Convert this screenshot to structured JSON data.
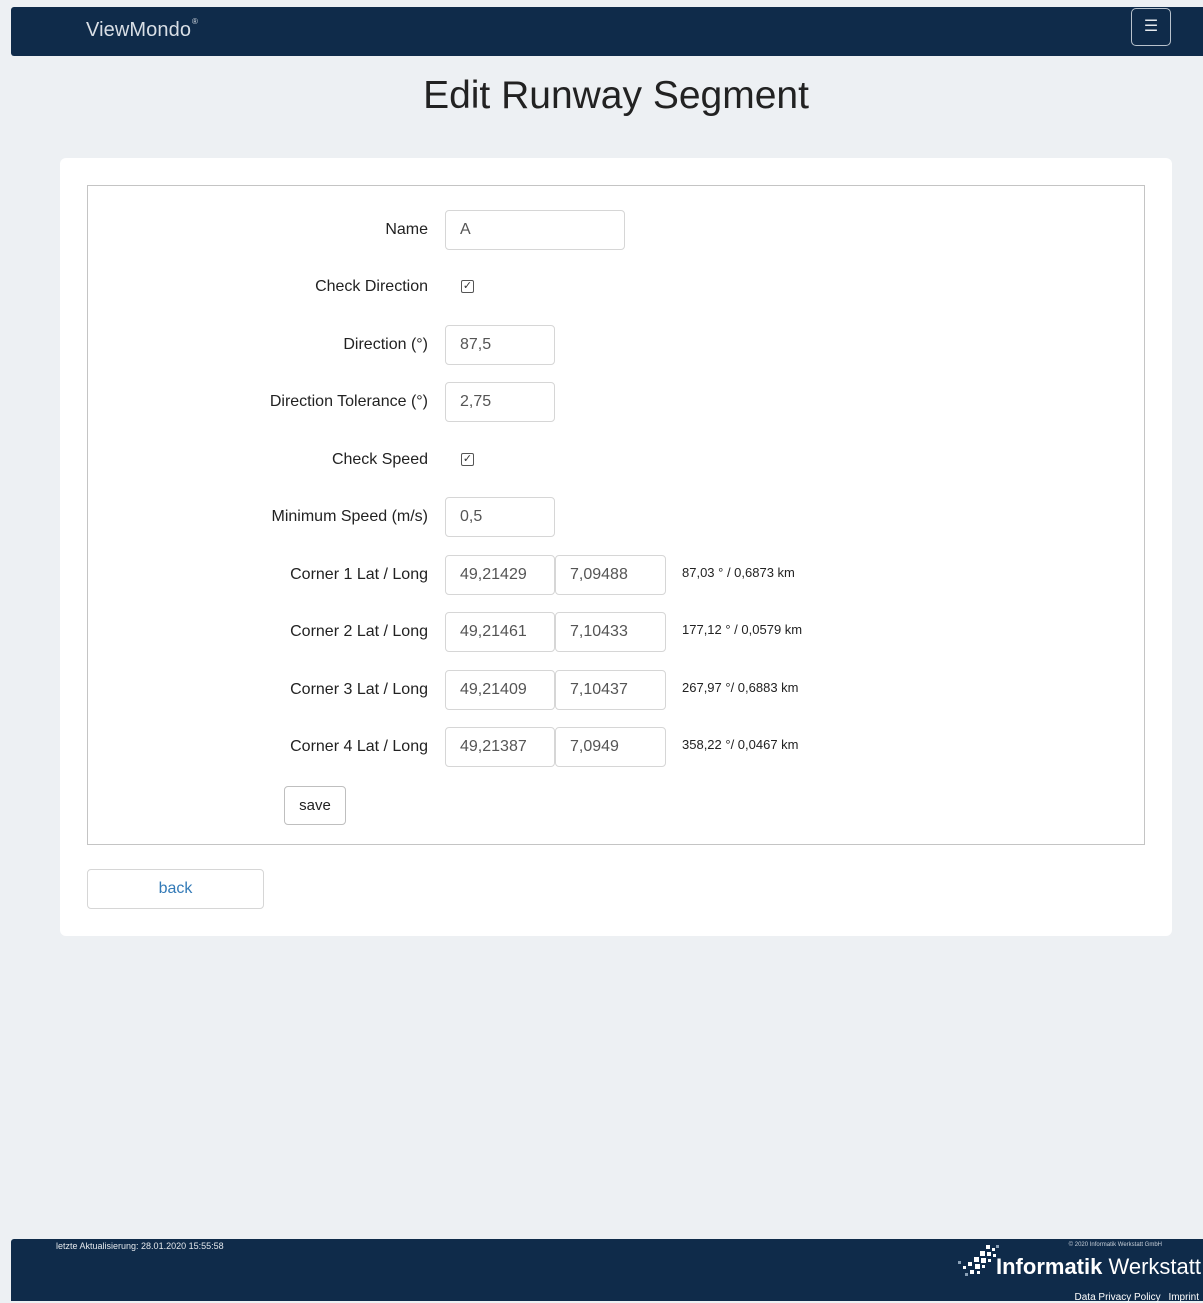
{
  "navbar": {
    "brand": "ViewMondo",
    "brand_mark": "®",
    "menu_icon": "hamburger-menu-icon"
  },
  "page": {
    "title": "Edit Runway Segment"
  },
  "form": {
    "name": {
      "label": "Name",
      "value": "A"
    },
    "check_direction": {
      "label": "Check Direction",
      "checked": true
    },
    "direction": {
      "label": "Direction (°)",
      "value": "87,5"
    },
    "direction_tolerance": {
      "label": "Direction Tolerance (°)",
      "value": "2,75"
    },
    "check_speed": {
      "label": "Check Speed",
      "checked": true
    },
    "minimum_speed": {
      "label": "Minimum Speed (m/s)",
      "value": "0,5"
    },
    "corners": [
      {
        "label": "Corner 1 Lat / Long",
        "lat": "49,21429",
        "long": "7,09488",
        "info": "87,03 ° / 0,6873 km"
      },
      {
        "label": "Corner 2 Lat / Long",
        "lat": "49,21461",
        "long": "7,10433",
        "info": "177,12 ° / 0,0579 km"
      },
      {
        "label": "Corner 3 Lat / Long",
        "lat": "49,21409",
        "long": "7,10437",
        "info": "267,97 °/ 0,6883 km"
      },
      {
        "label": "Corner 4 Lat / Long",
        "lat": "49,21387",
        "long": "7,0949",
        "info": "358,22 °/ 0,0467 km"
      }
    ],
    "save_label": "save"
  },
  "back_label": "back",
  "footer": {
    "updated": "letzte Aktualisierung: 28.01.2020 15:55:58",
    "copyright": "© 2020 Informatik Werkstatt GmbH",
    "logo_bold": "Informatik",
    "logo_regular": "Werkstatt",
    "links": [
      "Data Privacy Policy",
      "Imprint"
    ]
  },
  "colors": {
    "navbar": "#0f2b4a",
    "background": "#edf0f3",
    "link": "#337ab7"
  }
}
